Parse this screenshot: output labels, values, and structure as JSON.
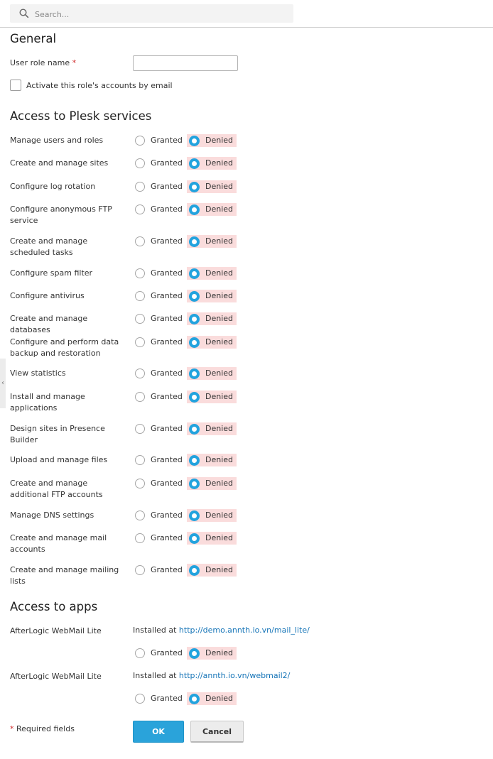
{
  "search": {
    "placeholder": "Search..."
  },
  "general": {
    "heading": "General",
    "role_name_label": "User role name",
    "required_mark": "*",
    "activate_label": "Activate this role's accounts by email"
  },
  "services": {
    "heading": "Access to Plesk services",
    "granted_label": "Granted",
    "denied_label": "Denied",
    "items": [
      {
        "label": "Manage users and roles",
        "value": "Denied"
      },
      {
        "label": "Create and manage sites",
        "value": "Denied"
      },
      {
        "label": "Configure log rotation",
        "value": "Denied"
      },
      {
        "label": "Configure anonymous FTP service",
        "value": "Denied"
      },
      {
        "label": "Create and manage scheduled tasks",
        "value": "Denied"
      },
      {
        "label": "Configure spam filter",
        "value": "Denied"
      },
      {
        "label": "Configure antivirus",
        "value": "Denied"
      },
      {
        "label": "Create and manage databases",
        "value": "Denied"
      },
      {
        "label": "Configure and perform data backup and restoration",
        "value": "Denied"
      },
      {
        "label": "View statistics",
        "value": "Denied"
      },
      {
        "label": "Install and manage applications",
        "value": "Denied"
      },
      {
        "label": "Design sites in Presence Builder",
        "value": "Denied"
      },
      {
        "label": "Upload and manage files",
        "value": "Denied"
      },
      {
        "label": "Create and manage additional FTP accounts",
        "value": "Denied"
      },
      {
        "label": "Manage DNS settings",
        "value": "Denied"
      },
      {
        "label": "Create and manage mail accounts",
        "value": "Denied"
      },
      {
        "label": "Create and manage mailing lists",
        "value": "Denied"
      }
    ]
  },
  "apps": {
    "heading": "Access to apps",
    "installed_prefix": "Installed at",
    "items": [
      {
        "name": "AfterLogic WebMail Lite",
        "url": "http://demo.annth.io.vn/mail_lite/",
        "value": "Denied"
      },
      {
        "name": "AfterLogic WebMail Lite",
        "url": "http://annth.io.vn/webmail2/",
        "value": "Denied"
      }
    ]
  },
  "footer": {
    "required_mark": "*",
    "required_text": "Required fields",
    "ok_label": "OK",
    "cancel_label": "Cancel"
  },
  "colors": {
    "accent": "#23a3de",
    "denied_bg": "#fadcdc",
    "link": "#1574b7",
    "required": "#d02b2b"
  },
  "side_handle_glyph": "‹"
}
